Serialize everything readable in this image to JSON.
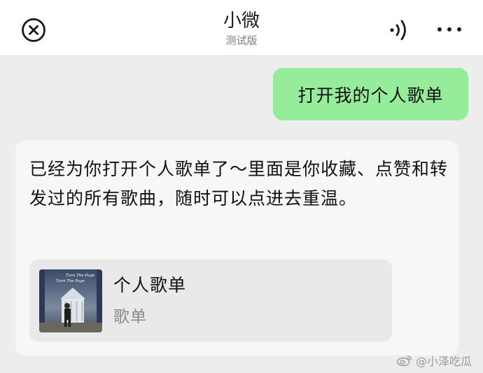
{
  "header": {
    "title": "小微",
    "subtitle": "测试版",
    "close_icon": "close-circle-icon",
    "sound_icon": "sound-wave-icon",
    "more_icon": "more-dots-icon"
  },
  "messages": {
    "user": {
      "text": "打开我的个人歌单"
    },
    "bot": {
      "text": "已经为你打开个人歌单了～里面是你收藏、点赞和转发过的所有歌曲，随时可以点进去重温。",
      "card": {
        "title": "个人歌单",
        "type": "歌单",
        "cover_text_1": "Turn The Page",
        "cover_text_2": "Turn The Page"
      }
    }
  },
  "watermark": {
    "text": "@小泽吃瓜"
  },
  "colors": {
    "user_bubble": "#95ec9a",
    "bot_bubble": "#f7f7f7",
    "card_bg": "#e9e9e9",
    "page_bg": "#ededed"
  }
}
